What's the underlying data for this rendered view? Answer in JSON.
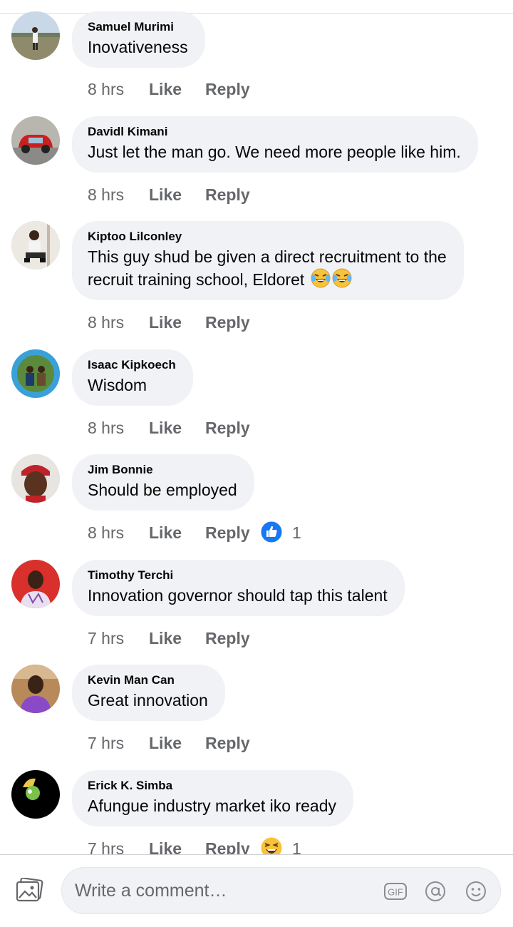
{
  "comments": [
    {
      "author": "Samuel Murimi",
      "text": "Inovativeness",
      "time": "8 hrs",
      "like": "Like",
      "reply": "Reply"
    },
    {
      "author": "Davidl Kimani",
      "text": "Just let the man go. We need more people like him.",
      "time": "8 hrs",
      "like": "Like",
      "reply": "Reply"
    },
    {
      "author": "Kiptoo Lilconley",
      "text_line1": "This guy shud be given a direct recruitment to the",
      "text_line2": "recruit training school, Eldoret",
      "time": "8 hrs",
      "like": "Like",
      "reply": "Reply"
    },
    {
      "author": "Isaac Kipkoech",
      "text": "Wisdom",
      "time": "8 hrs",
      "like": "Like",
      "reply": "Reply"
    },
    {
      "author": "Jim Bonnie",
      "text": "Should be employed",
      "time": "8 hrs",
      "like": "Like",
      "reply": "Reply",
      "reaction": {
        "icon": "thumbs-up-icon",
        "count": "1"
      }
    },
    {
      "author": "Timothy Terchi",
      "text": "Innovation governor should tap this talent",
      "time": "7 hrs",
      "like": "Like",
      "reply": "Reply"
    },
    {
      "author": "Kevin Man Can",
      "text": "Great innovation",
      "time": "7 hrs",
      "like": "Like",
      "reply": "Reply"
    },
    {
      "author": "Erick K. Simba",
      "text": "Afungue industry market iko ready",
      "time": "7 hrs",
      "like": "Like",
      "reply": "Reply",
      "reaction": {
        "icon": "laughing-emoji-icon",
        "count": "1"
      }
    }
  ],
  "composer": {
    "placeholder": "Write a comment…",
    "icons": [
      "photo-icon",
      "gif-icon",
      "mention-icon",
      "emoji-icon"
    ],
    "gif_label": "GIF"
  },
  "colors": {
    "bubble": "#f0f2f5",
    "meta_text": "#65676b",
    "like_blue": "#1877f2",
    "text": "#050505"
  }
}
